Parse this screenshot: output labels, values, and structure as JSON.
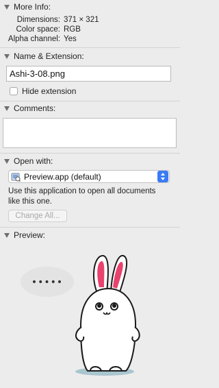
{
  "more_info": {
    "title": "More Info:",
    "rows": [
      {
        "label": "Dimensions:",
        "value": "371 × 321"
      },
      {
        "label": "Color space:",
        "value": "RGB"
      },
      {
        "label": "Alpha channel:",
        "value": "Yes"
      }
    ]
  },
  "name_extension": {
    "title": "Name & Extension:",
    "filename": "Ashi-3-08.png",
    "hide_extension_label": "Hide extension"
  },
  "comments": {
    "title": "Comments:",
    "value": ""
  },
  "open_with": {
    "title": "Open with:",
    "app_icon": "preview-app-icon",
    "selected_app": "Preview.app (default)",
    "hint_line1": "Use this application to open all documents",
    "hint_line2": "like this one.",
    "change_all_label": "Change All..."
  },
  "preview": {
    "title": "Preview:",
    "speech_text": "•••••"
  },
  "colors": {
    "window_bg": "#ececec",
    "accent": "#3a7bf5",
    "bunny_ear_inner": "#e8436e",
    "shadow": "#a9c6cf"
  }
}
